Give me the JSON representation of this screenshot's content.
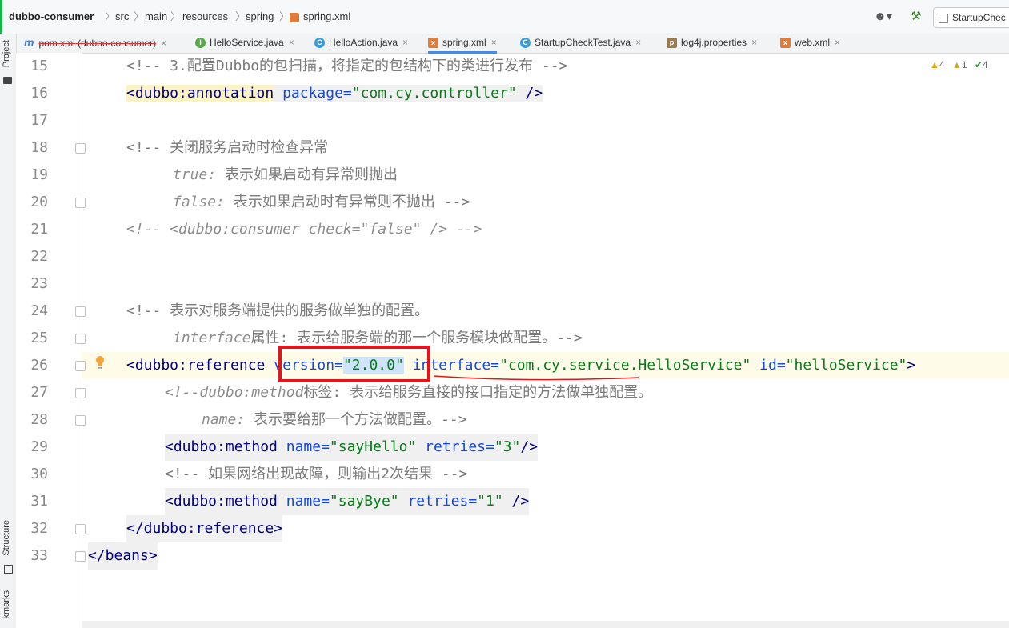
{
  "breadcrumb": {
    "project": "dubbo-consumer",
    "parts": [
      "src",
      "main",
      "resources",
      "spring"
    ],
    "file": "spring.xml"
  },
  "toolbar": {
    "run_config": "StartupChec"
  },
  "tabs": [
    {
      "label": "pom.xml (dubbo-consumer)",
      "icon": "maven-icon",
      "color": "#3b7dd8",
      "glyph": "m"
    },
    {
      "label": "HelloService.java",
      "icon": "interface-icon",
      "color": "#5aa64a",
      "glyph": "I"
    },
    {
      "label": "HelloAction.java",
      "icon": "class-icon",
      "color": "#3b9ed8",
      "glyph": "C"
    },
    {
      "label": "spring.xml",
      "icon": "xml-icon",
      "color": "#e07b39",
      "glyph": "x"
    },
    {
      "label": "StartupCheckTest.java",
      "icon": "test-class-icon",
      "color": "#3b9ed8",
      "glyph": "C"
    },
    {
      "label": "log4j.properties",
      "icon": "properties-icon",
      "color": "#9a7b4f",
      "glyph": "p"
    },
    {
      "label": "web.xml",
      "icon": "xml-icon",
      "color": "#e07b39",
      "glyph": "x"
    }
  ],
  "sidebar": {
    "project": "Project",
    "structure": "Structure",
    "bookmarks": "kmarks"
  },
  "inspections": {
    "warnings": "4",
    "weak_warnings": "1",
    "ok": "4"
  },
  "lines": {
    "n15": "15",
    "n16": "16",
    "n17": "17",
    "n18": "18",
    "n19": "19",
    "n20": "20",
    "n21": "21",
    "n22": "22",
    "n23": "23",
    "n24": "24",
    "n25": "25",
    "n26": "26",
    "n27": "27",
    "n28": "28",
    "n29": "29",
    "n30": "30",
    "n31": "31",
    "n32": "32",
    "n33": "33"
  },
  "code": {
    "l15": "<!-- 3.配置Dubbo的包扫描，将指定的包结构下的类进行发布 -->",
    "l16_tag": "<dubbo:annotation",
    "l16_attr": "package=",
    "l16_val": "\"com.cy.controller\"",
    "l16_end": "/>",
    "l18": "<!-- 关闭服务启动时检查异常",
    "l19_kw": "true:",
    "l19_txt": "表示如果启动有异常则抛出",
    "l20_kw": "false:",
    "l20_txt": "表示如果启动时有异常则不抛出 -->",
    "l21": "<!-- <dubbo:consumer check=\"false\" /> -->",
    "l24": "<!-- 表示对服务端提供的服务做单独的配置。",
    "l25_kw": "interface",
    "l25_txt": "属性: 表示给服务端的那一个服务模块做配置。-->",
    "l26_tag": "<dubbo:reference",
    "l26_attr1": "version=",
    "l26_val1": "\"2.0.0\"",
    "l26_attr2": "interface=",
    "l26_val2": "\"com.cy.service.HelloService\"",
    "l26_attr3": "id=",
    "l26_val3": "\"helloService\"",
    "l26_end": ">",
    "l27_a": "<!--",
    "l27_kw": "dubbo:method",
    "l27_txt": "标签: 表示给服务直接的接口指定的方法做单独配置。",
    "l28_kw": "name:",
    "l28_txt": "表示要给那一个方法做配置。-->",
    "l29_tag": "<dubbo:method",
    "l29_attr1": "name=",
    "l29_val1": "\"sayHello\"",
    "l29_attr2": "retries=",
    "l29_val2": "\"3\"",
    "l29_end": "/>",
    "l30": "<!-- 如果网络出现故障，则输出2次结果 -->",
    "l31_tag": "<dubbo:method",
    "l31_attr1": "name=",
    "l31_val1": "\"sayBye\"",
    "l31_attr2": "retries=",
    "l31_val2": "\"1\"",
    "l31_end": "/>",
    "l32": "</dubbo:reference>",
    "l33": "</beans>"
  }
}
